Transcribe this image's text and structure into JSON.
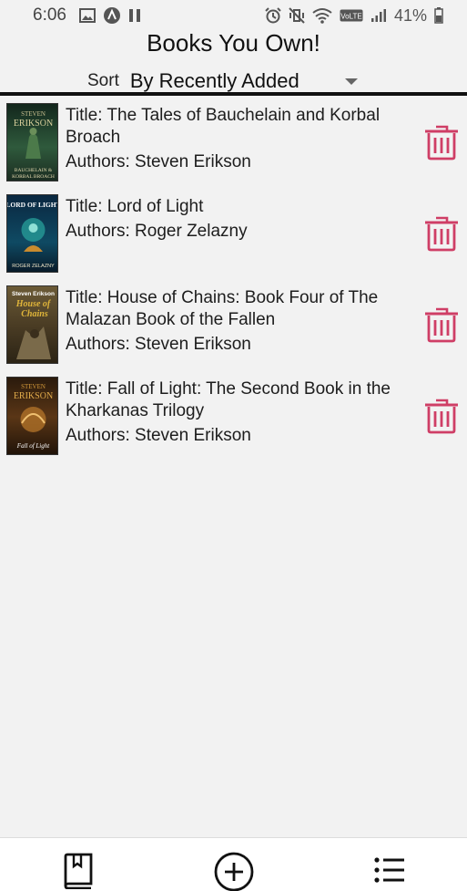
{
  "status_bar": {
    "time": "6:06",
    "left_icons": [
      "image-icon",
      "app-a-icon",
      "pause-icon"
    ],
    "right_icons": [
      "alarm-icon",
      "vibrate-icon",
      "wifi-icon",
      "volte-icon",
      "signal-icon",
      "battery-icon"
    ],
    "volte_label": "VoLTE",
    "battery_percent": "41%"
  },
  "header": {
    "title": "Books You Own!",
    "sort_label": "Sort",
    "sort_value": "By Recently Added"
  },
  "books": [
    {
      "title_text": "Title: The Tales of Bauchelain and Korbal Broach",
      "authors_text": "Authors: Steven Erikson",
      "cover": {
        "top_text": "STEVEN",
        "author_text": "ERIKSON",
        "bottom_text_1": "BAUCHELAIN &",
        "bottom_text_2": "KORBAL BROACH",
        "bg_color": "#1f3a2a",
        "accent_color": "#6b8f5a"
      }
    },
    {
      "title_text": "Title: Lord of Light",
      "authors_text": "Authors: Roger Zelazny",
      "cover": {
        "top_text": "LORD OF LIGHT",
        "bottom_text_1": "ROGER ZELAZNY",
        "bg_color": "#0e3550",
        "accent_color": "#2aa7a0"
      }
    },
    {
      "title_text": "Title: House of Chains: Book Four of The Malazan Book of the Fallen",
      "authors_text": "Authors: Steven Erikson",
      "cover": {
        "top_text": "Steven Erikson",
        "author_text": "House of",
        "bottom_text_1": "Chains",
        "bg_color": "#5a4a2c",
        "accent_color": "#e0b53a"
      }
    },
    {
      "title_text": "Title: Fall of Light: The Second Book in the Kharkanas Trilogy",
      "authors_text": "Authors: Steven Erikson",
      "cover": {
        "top_text": "STEVEN",
        "author_text": "ERIKSON",
        "bottom_text_1": "Fall of Light",
        "bg_color": "#3a2412",
        "accent_color": "#d49a3a"
      }
    }
  ],
  "colors": {
    "delete_accent": "#cf3e66",
    "background": "#f2f2f2",
    "divider": "#111111"
  },
  "bottom_nav": {
    "items": [
      "book-icon",
      "add-circle-icon",
      "list-icon"
    ]
  }
}
